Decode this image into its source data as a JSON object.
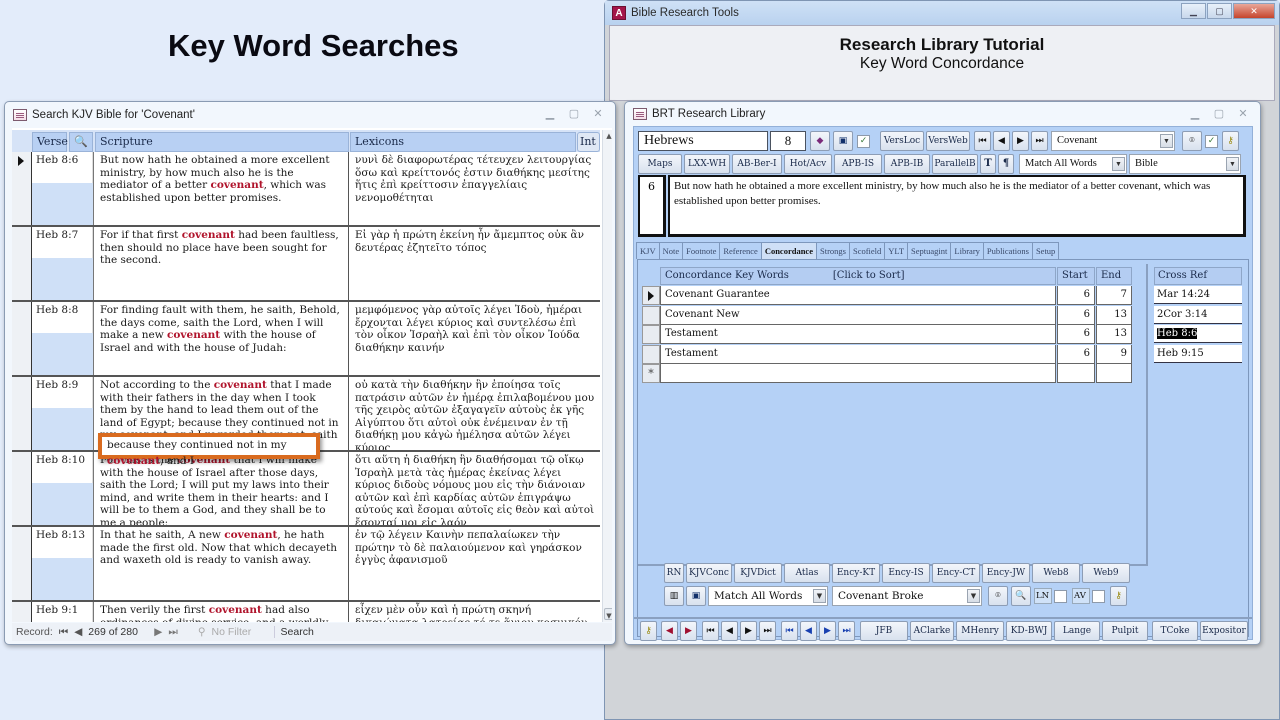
{
  "page_heading": "Key Word Searches",
  "search_window": {
    "title": "Search KJV Bible for 'Covenant'",
    "columns": {
      "verse": "Verse",
      "scripture": "Scripture",
      "lexicons": "Lexicons",
      "int_button": "Int"
    },
    "rows": [
      {
        "verse": "Heb 8:6",
        "scripture_pre": "But now hath he obtained a more excellent ministry, by how much also he is the mediator of a better ",
        "keyword": "covenant",
        "scripture_post": ", which was established upon better promises.",
        "lexicon": "νυνὶ δὲ διαφορωτέρας τέτευχεν λειτουργίας ὅσω καὶ κρείττονός ἐστιν διαθήκης μεσίτης ἥτις ἐπὶ κρείττοσιν ἐπαγγελίαις νενομοθέτηται"
      },
      {
        "verse": "Heb 8:7",
        "scripture_pre": "For if that first ",
        "keyword": "covenant",
        "scripture_post": " had been faultless, then should no place have been sought for the second.",
        "lexicon": "Εἰ γὰρ ἡ πρώτη ἐκείνη ἦν ἄμεμπτος οὐκ ἂν δευτέρας ἐζητεῖτο τόπος"
      },
      {
        "verse": "Heb 8:8",
        "scripture_pre": "For finding fault with them, he saith, Behold, the days come, saith the Lord, when I will make a new ",
        "keyword": "covenant",
        "scripture_post": " with the house of Israel and with the house of Judah:",
        "lexicon": "μεμφόμενος γὰρ αὐτοῖς λέγει Ἰδοὺ, ἡμέραι ἔρχονται λέγει κύριος καὶ συντελέσω ἐπὶ τὸν οἶκον Ἰσραὴλ καὶ ἐπὶ τὸν οἶκον Ἰούδα διαθήκην καινήν"
      },
      {
        "verse": "Heb 8:9",
        "scripture_pre": "Not according to the ",
        "keyword": "covenant",
        "scripture_post": " that I made with their fathers in the day when I took them by the hand to lead them out of the land of Egypt; because they continued not in my covenant, and I regarded them not, saith the Lord.",
        "lexicon": "οὐ κατὰ τὴν διαθήκην ἣν ἐποίησα τοῖς πατράσιν αὐτῶν ἐν ἡμέρᾳ ἐπιλαβομένου μου τῆς χειρὸς αὐτῶν ἐξαγαγεῖν αὐτοὺς ἐκ γῆς Αἰγύπτου ὅτι αὐτοὶ οὐκ ἐνέμειναν ἐν τῇ διαθήκῃ μου κἀγὼ ἠμέλησα αὐτῶν λέγει κύριος"
      },
      {
        "verse": "Heb 8:10",
        "scripture_pre": "For this is the ",
        "keyword": "covenant",
        "scripture_post": " that I will make with the house of Israel after those days, saith the Lord; I will put my laws into their mind, and write them in their hearts: and I will be to them a God, and they shall be to me a people:",
        "lexicon": "ὅτι αὕτη ἡ διαθήκη ἣν διαθήσομαι τῷ οἴκῳ Ἰσραὴλ μετὰ τὰς ἡμέρας ἐκείνας λέγει κύριος διδοὺς νόμους μου εἰς τὴν διάνοιαν αὐτῶν καὶ ἐπὶ καρδίας αὐτῶν ἐπιγράψω αὐτούς καὶ ἔσομαι αὐτοῖς εἰς θεὸν καὶ αὐτοὶ ἔσονταί μοι εἰς λαόν"
      },
      {
        "verse": "Heb 8:13",
        "scripture_pre": "In that he saith, A new ",
        "keyword": "covenant",
        "scripture_post": ", he hath made the first old. Now that which decayeth and waxeth old is ready to vanish away.",
        "lexicon": "ἐν τῷ λέγειν Καινὴν πεπαλαίωκεν τὴν πρώτην τὸ δὲ παλαιούμενον καὶ γηράσκον ἐγγὺς ἀφανισμοῦ"
      },
      {
        "verse": "Heb 9:1",
        "scripture_pre": "Then verily the first ",
        "keyword": "covenant",
        "scripture_post": " had also ordinances of divine service, and a worldly sanctuary.",
        "lexicon": "εἶχεν μὲν οὖν καὶ ἡ πρώτη σκηνή δικαιώματα λατρείας τό τε ἅγιον κοσμικόν"
      }
    ],
    "callout": {
      "pre": "because they continued not in my ",
      "keyword": "covenant",
      "post": ", and I"
    },
    "status": {
      "record_label": "Record:",
      "record_value": "269 of 280",
      "filter": "No Filter",
      "search": "Search"
    }
  },
  "main_window": {
    "title": "Bible Research Tools",
    "tutorial_title": "Research Library Tutorial",
    "tutorial_subtitle": "Key Word Concordance"
  },
  "library_window": {
    "title": "BRT Research Library",
    "book": "Hebrews",
    "chapter": "8",
    "toolbar1": {
      "versloc": "VersLoc",
      "versweb": "VersWeb",
      "search_term": "Covenant"
    },
    "toolbar2": [
      "Maps",
      "LXX-WH",
      "AB-Ber-I",
      "Hot/Acv",
      "APB-IS",
      "APB-IB",
      "ParallelB",
      "T",
      "¶"
    ],
    "match_mode": "Match All Words",
    "source": "Bible",
    "verse_number": "6",
    "verse_text": "But now hath he obtained a more excellent ministry, by how much also he is the mediator of a better covenant, which was established upon better promises.",
    "tabs": [
      "KJV",
      "Note",
      "Footnote",
      "Reference",
      "Concordance",
      "Strongs",
      "Scofield",
      "YLT",
      "Septuagint",
      "Library",
      "Publications",
      "Setup"
    ],
    "active_tab": "Concordance",
    "concordance": {
      "header_key": "Concordance Key Words",
      "header_sort": "[Click to Sort]",
      "header_start": "Start",
      "header_end": "End",
      "rows": [
        {
          "word": "Covenant Guarantee",
          "start": "6",
          "end": "7"
        },
        {
          "word": "Covenant New",
          "start": "6",
          "end": "13"
        },
        {
          "word": "Testament",
          "start": "6",
          "end": "13"
        },
        {
          "word": "Testament",
          "start": "6",
          "end": "9"
        }
      ],
      "new_row_marker": "*"
    },
    "cross_ref": {
      "header": "Cross Ref",
      "items": [
        "Mar 14:24",
        "2Cor 3:14",
        "Heb 8:6",
        "Heb 9:15"
      ],
      "selected": "Heb 8:6"
    },
    "ref_buttons": [
      "RN",
      "KJVConc",
      "KJVDict",
      "Atlas",
      "Ency-KT",
      "Ency-IS",
      "Ency-CT",
      "Ency-JW",
      "Web8",
      "Web9"
    ],
    "bottom_match_mode": "Match All Words",
    "bottom_search": "Covenant Broke",
    "ln_label": "LN",
    "av_label": "AV",
    "commentary_buttons": [
      "JFB",
      "AClarke",
      "MHenry",
      "KD-BWJ",
      "Lange",
      "Pulpit",
      "TCoke",
      "Expositor"
    ]
  }
}
